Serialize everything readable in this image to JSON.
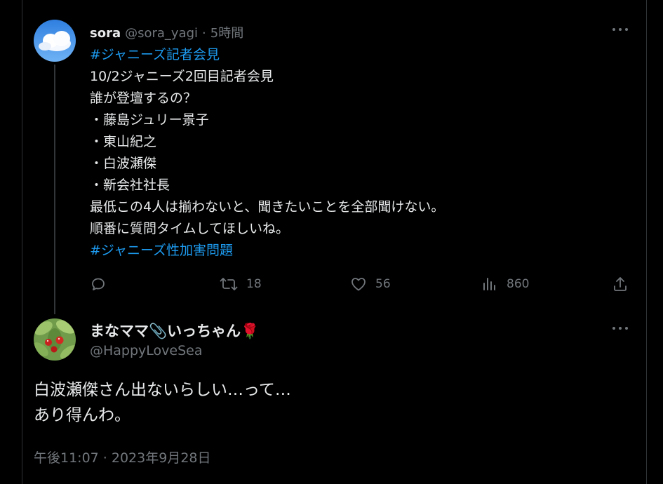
{
  "original_tweet": {
    "display_name": "sora",
    "handle": "@sora_yagi",
    "separator": "·",
    "time": "5時間",
    "lines": [
      {
        "text": "#ジャニーズ記者会見",
        "hashtag": true
      },
      {
        "text": "10/2ジャニーズ2回目記者会見",
        "hashtag": false
      },
      {
        "text": "誰が登壇するの？",
        "hashtag": false
      },
      {
        "text": "・藤島ジュリー景子",
        "hashtag": false
      },
      {
        "text": "・東山紀之",
        "hashtag": false
      },
      {
        "text": "・白波瀬傑",
        "hashtag": false
      },
      {
        "text": "・新会社社長",
        "hashtag": false
      },
      {
        "text": "最低この4人は揃わないと、聞きたいことを全部聞けない。",
        "hashtag": false
      },
      {
        "text": "順番に質問タイムしてほしいね。",
        "hashtag": false
      },
      {
        "text": "#ジャニーズ性加害問題",
        "hashtag": true
      }
    ],
    "actions": {
      "reply_icon": "reply-icon",
      "retweet_icon": "retweet-icon",
      "retweets": "18",
      "like_icon": "heart-icon",
      "likes": "56",
      "views_icon": "views-chart-icon",
      "views": "860",
      "share_icon": "share-icon"
    }
  },
  "reply_tweet": {
    "display_name": "まなママ📎いっちゃん🌹",
    "handle": "@HappyLoveSea",
    "lines": [
      "白波瀬傑さん出ないらしい…って…",
      "あり得んわ。"
    ],
    "timestamp": "午後11:07 · 2023年9月28日"
  },
  "colors": {
    "background": "#000000",
    "text": "#e7e9ea",
    "muted": "#71767b",
    "link": "#1d9bf0"
  }
}
